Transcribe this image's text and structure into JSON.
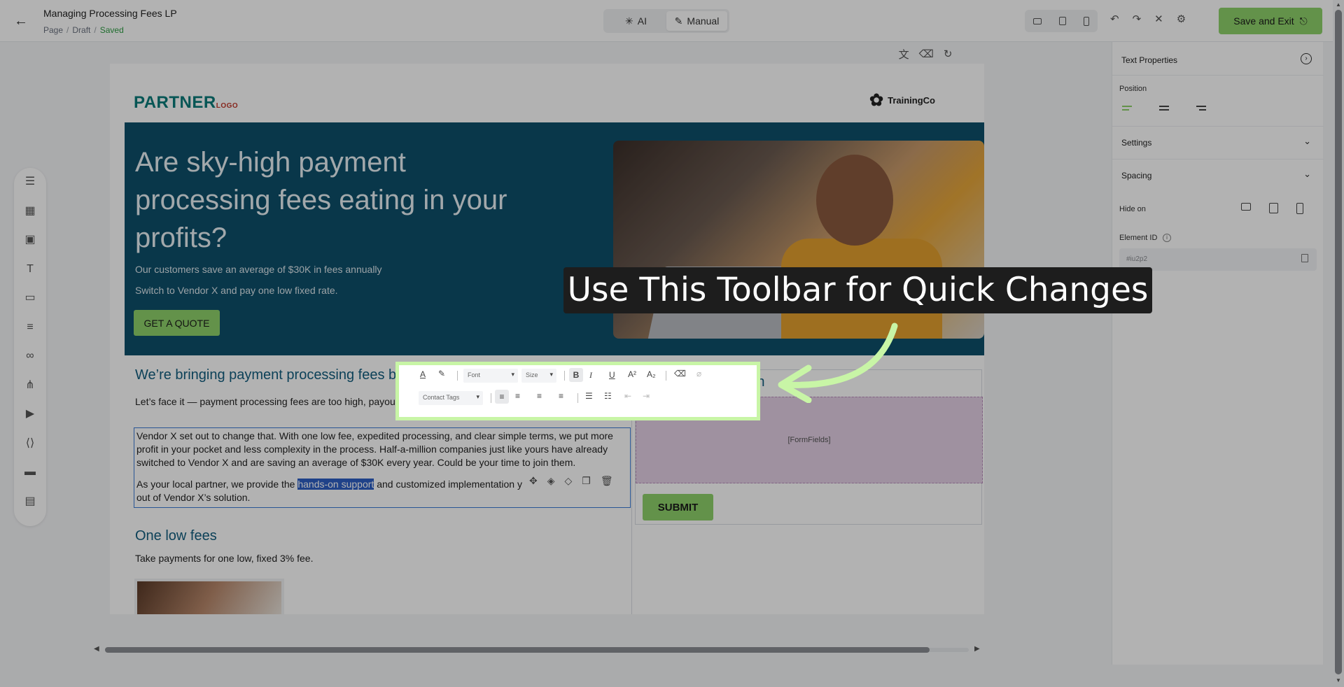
{
  "topbar": {
    "title": "Managing Processing Fees LP",
    "breadcrumb": [
      "Page",
      "Draft",
      "Saved"
    ],
    "modes": [
      {
        "label": "AI",
        "active": false
      },
      {
        "label": "Manual",
        "active": true
      }
    ],
    "save_exit": "Save and Exit"
  },
  "page": {
    "logo_left_main": "PARTNER",
    "logo_left_small": "LOGO",
    "logo_right": "TrainingCo",
    "hero": {
      "headline": "Are sky-high payment processing fees eating in your profits?",
      "line1": "Our customers save an average of $30K in fees annually",
      "line2": "Switch to Vendor X and pay one low fixed rate.",
      "cta": "GET A QUOTE"
    },
    "section_heading": "We’re bringing payment processing fees bac",
    "intro_text": "Let’s face it — payment processing fees are too high, payout tak mysterious.",
    "paragraph1": "Vendor X set out to change that. With one low fee, expedited processing, and clear simple terms, we put more profit in your pocket and less complexity in the process. Half-a-million companies just like yours have already switched to Vendor X and are saving an average of $30K every year. Could be your time to join them.",
    "paragraph2_before": "As your local partner, we provide the ",
    "paragraph2_selected": "hands-on support",
    "paragraph2_after": " and customized implementation y",
    "paragraph2_end": "out of Vendor X’s solution.",
    "form_title_partial": "artn",
    "form_fields_placeholder": "[FormFields]",
    "submit": "SUBMIT",
    "fees_heading": "One low fees",
    "fees_text": "Take payments for one low, fixed 3% fee."
  },
  "toolbar": {
    "font_placeholder": "Font",
    "size_placeholder": "Size",
    "contact_tags": "Contact Tags",
    "bold": "B",
    "italic": "I",
    "underline": "U",
    "superscript": "A²",
    "subscript": "A₂",
    "text_color_glyph": "A"
  },
  "callout": {
    "text": "Use This Toolbar for Quick Changes"
  },
  "right_panel": {
    "title": "Text Properties",
    "position_label": "Position",
    "settings_label": "Settings",
    "spacing_label": "Spacing",
    "hide_on_label": "Hide on",
    "element_id_label": "Element ID",
    "element_id_value": "#iu2p2"
  },
  "colors": {
    "accent_green": "#8fd16a",
    "hero_blue": "#0d4f6b",
    "heading_blue": "#125d7f",
    "selection_blue": "#2d5fc4",
    "toolbar_highlight": "#c8f5a6"
  },
  "icons": {
    "left_tools": [
      "section-icon",
      "layout-icon",
      "image-icon",
      "text-icon",
      "button-icon",
      "divider-icon",
      "link-icon",
      "social-icon",
      "video-icon",
      "code-icon",
      "footer-icon",
      "form-icon"
    ]
  }
}
